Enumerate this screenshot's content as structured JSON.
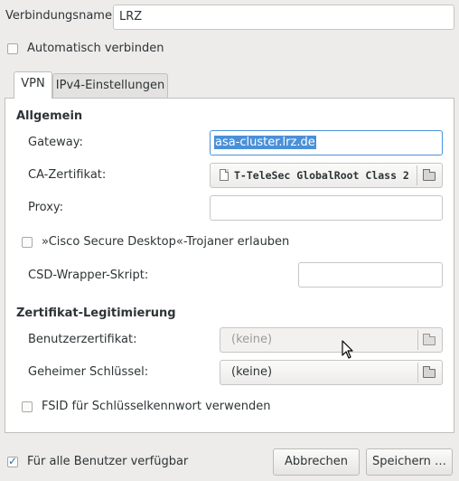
{
  "connection": {
    "name_label": "Verbindungsname:",
    "name_value": "LRZ",
    "autoconnect_label": "Automatisch verbinden",
    "autoconnect_checked": false
  },
  "tabs": [
    {
      "label": "VPN",
      "active": true
    },
    {
      "label": "IPv4-Einstellungen",
      "active": false
    }
  ],
  "general": {
    "section_title": "Allgemein",
    "gateway_label": "Gateway:",
    "gateway_value": "asa-cluster.lrz.de",
    "ca_label": "CA-Zertifikat:",
    "ca_value": "T-TeleSec GlobalRoot Class 2",
    "proxy_label": "Proxy:",
    "proxy_value": "",
    "csd_checkbox_label": "»Cisco Secure Desktop«-Trojaner erlauben",
    "csd_checked": false,
    "csd_wrapper_label": "CSD-Wrapper-Skript:",
    "csd_wrapper_value": ""
  },
  "auth": {
    "section_title": "Zertifikat-Legitimierung",
    "user_cert_label": "Benutzerzertifikat:",
    "user_cert_value": "(keine)",
    "private_key_label": "Geheimer Schlüssel:",
    "private_key_value": "(keine)",
    "fsid_label": "FSID für Schlüsselkennwort verwenden",
    "fsid_checked": false
  },
  "footer": {
    "all_users_label": "Für alle Benutzer verfügbar",
    "all_users_checked": true,
    "cancel_label": "Abbrechen",
    "save_label": "Speichern …"
  },
  "colors": {
    "window_bg": "#edeceb",
    "panel_bg": "#ffffff",
    "accent": "#4a90d9",
    "text": "#2e3436",
    "disabled_text": "#9a9c98"
  },
  "icons": [
    "folder-icon",
    "certificate-file-icon",
    "mouse-pointer-icon",
    "checkmark-icon"
  ]
}
